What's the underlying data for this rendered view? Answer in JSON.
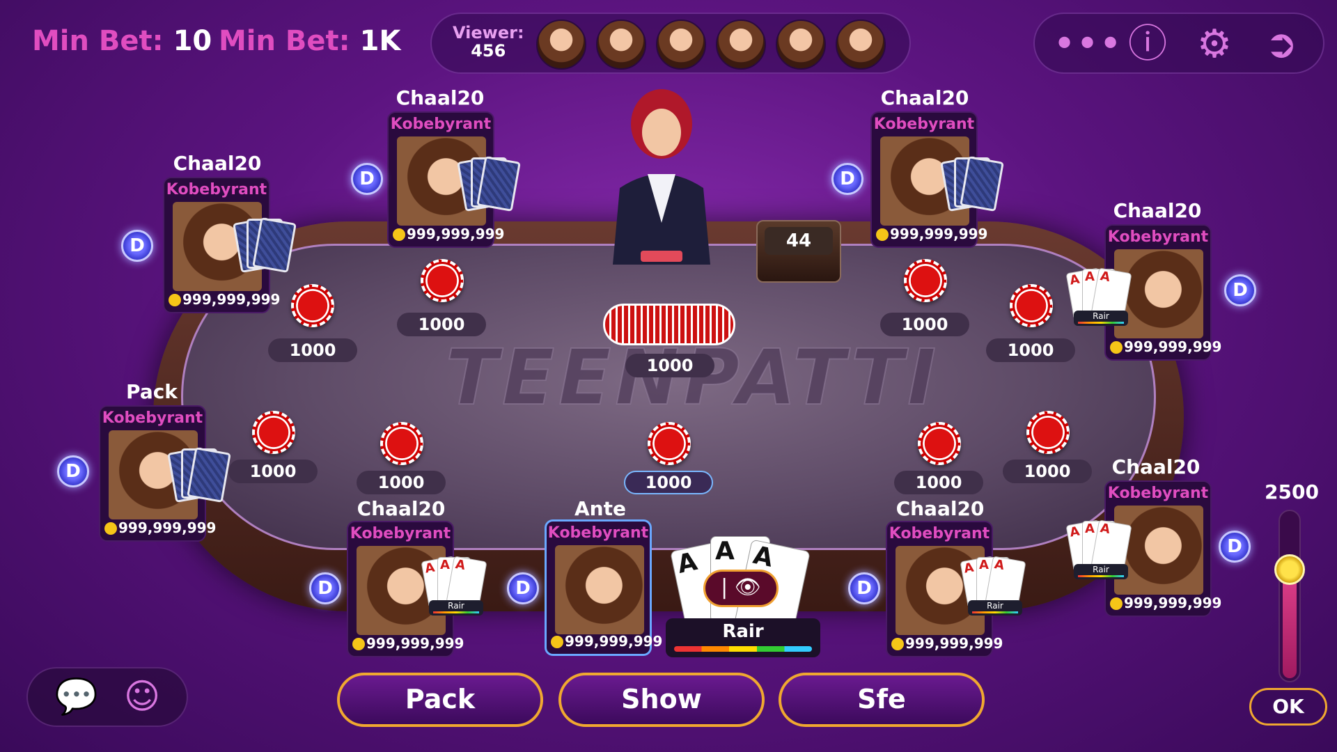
{
  "header": {
    "min_bet_1_label": "Min Bet:",
    "min_bet_1_value": "10",
    "min_bet_2_label": "Min Bet:",
    "min_bet_2_value": "1K",
    "viewer_label": "Viewer:",
    "viewer_count": "456",
    "menu_icons": [
      "more-icon",
      "help-icon",
      "gear-icon",
      "exit-icon"
    ]
  },
  "table": {
    "logo": "TEENPATTI",
    "deck_count": "44",
    "pot": "1000"
  },
  "seats": [
    {
      "status": "Chaal20",
      "name": "Kobebyrant",
      "coins": "999,999,999"
    },
    {
      "status": "Chaal20",
      "name": "Kobebyrant",
      "coins": "999,999,999"
    },
    {
      "status": "Chaal20",
      "name": "Kobebyrant",
      "coins": "999,999,999"
    },
    {
      "status": "Chaal20",
      "name": "Kobebyrant",
      "coins": "999,999,999",
      "hand": "Rair"
    },
    {
      "status": "Pack",
      "name": "Kobebyrant",
      "coins": "999,999,999"
    },
    {
      "status": "Chaal20",
      "name": "Kobebyrant",
      "coins": "999,999,999",
      "hand": "Rair"
    },
    {
      "status": "Ante",
      "name": "Kobebyrant",
      "coins": "999,999,999"
    },
    {
      "status": "Chaal20",
      "name": "Kobebyrant",
      "coins": "999,999,999",
      "hand": "Rair"
    },
    {
      "status": "Chaal20",
      "name": "Kobebyrant",
      "coins": "999,999,999",
      "hand": "Rair"
    }
  ],
  "bets": [
    "1000",
    "1000",
    "1000",
    "1000",
    "1000",
    "1000",
    "1000",
    "1000",
    "1000",
    "1000"
  ],
  "my_hand": {
    "name": "Rair",
    "card_rank": "A"
  },
  "actions": {
    "pack": "Pack",
    "show": "Show",
    "sfe": "Sfe"
  },
  "slider": {
    "value": "2500",
    "ok": "OK",
    "level": 0.63
  },
  "chat_icons": [
    "chat-icon",
    "emoji-icon"
  ],
  "dealer_chip_letter": "D"
}
